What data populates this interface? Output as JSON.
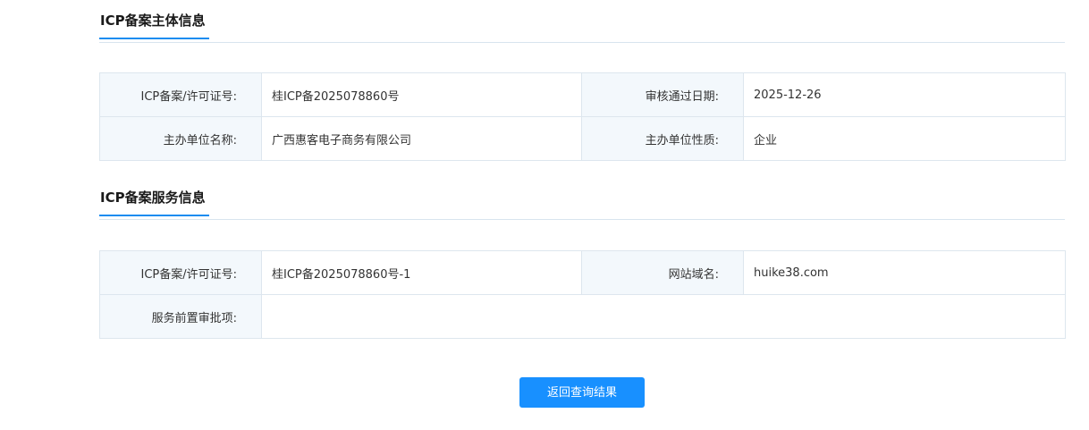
{
  "subject_section": {
    "title": "ICP备案主体信息",
    "rows": [
      [
        {
          "label": "ICP备案/许可证号:",
          "value": "桂ICP备2025078860号"
        },
        {
          "label": "审核通过日期:",
          "value": "2025-12-26"
        }
      ],
      [
        {
          "label": "主办单位名称:",
          "value": "广西惠客电子商务有限公司"
        },
        {
          "label": "主办单位性质:",
          "value": "企业"
        }
      ]
    ]
  },
  "service_section": {
    "title": "ICP备案服务信息",
    "rows": [
      [
        {
          "label": "ICP备案/许可证号:",
          "value": "桂ICP备2025078860号-1"
        },
        {
          "label": "网站域名:",
          "value": "huike38.com"
        }
      ],
      [
        {
          "label": "服务前置审批项:",
          "value": ""
        }
      ]
    ]
  },
  "actions": {
    "back_label": "返回查询结果"
  },
  "colors": {
    "accent": "#1890ff",
    "label_bg": "#f3f8fc",
    "border": "#dde6ee"
  }
}
